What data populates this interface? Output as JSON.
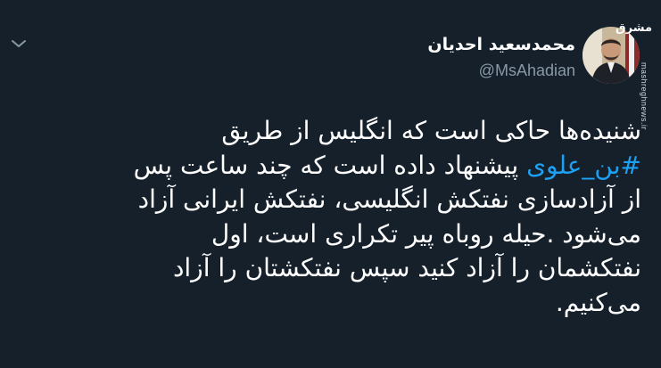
{
  "user": {
    "display_name": "محمدسعید احدیان",
    "handle": "@MsAhadian"
  },
  "watermark": {
    "logo_text": "مشرق",
    "site_text": "mashreghnews.ir"
  },
  "tweet": {
    "line1": "شنیده‌ها حاکی است که انگلیس از طریق",
    "hashtag": "#بن_علوی",
    "line2_rest": " پیشنهاد داده است که چند ساعت پس",
    "line3": "از آزادسازی نفتکش انگلیسی، نفتکش ایرانی آزاد",
    "line4": "می‌شود .حیله روباه پیر تکراری است، اول",
    "line5": "نفتکشمان را آزاد کنید سپس نفتکشتان را آزاد",
    "line6": "می‌کنیم."
  },
  "colors": {
    "background": "#15202b",
    "text": "#ffffff",
    "secondary": "#8899a6",
    "link": "#1da1f2"
  },
  "icons": {
    "menu": "chevron-down-icon",
    "avatar": "avatar"
  }
}
